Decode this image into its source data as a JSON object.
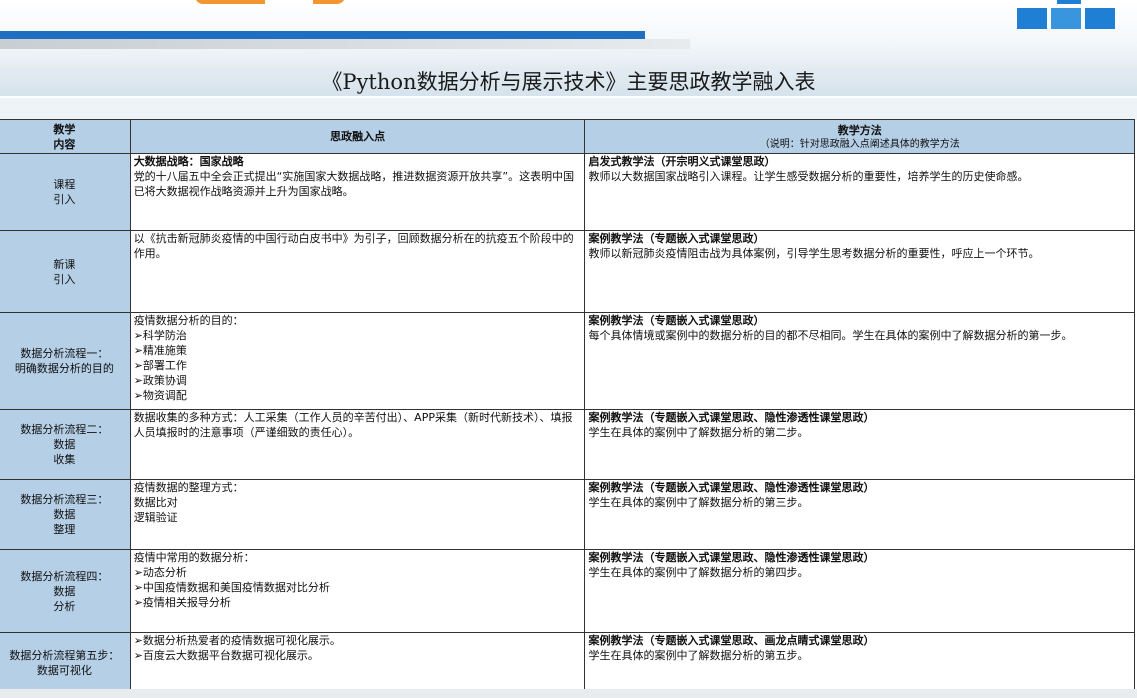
{
  "title": "《Python数据分析与展示技术》主要思政教学融入表",
  "table": {
    "headers": {
      "c1_line1": "教学",
      "c1_line2": "内容",
      "c2": "思政融入点",
      "c3_line1": "教学方法",
      "c3_line2": "（说明：针对思政融入点阐述具体的教学方法"
    },
    "rows": [
      {
        "content": [
          "课程",
          "引入"
        ],
        "point_title": "大数据战略：国家战略",
        "point_lines": [
          "党的十八届五中全会正式提出“实施国家大数据战略，推进数据资源开放共享”。这表明中国已将大数据视作战略资源并上升为国家战略。"
        ],
        "method_title": "启发式教学法（开宗明义式课堂思政）",
        "method_text": "教师以大数据国家战略引入课程。让学生感受数据分析的重要性，培养学生的历史使命感。"
      },
      {
        "content": [
          "新课",
          "引入"
        ],
        "point_title": "",
        "point_lines": [
          "以《抗击新冠肺炎疫情的中国行动白皮书中》为引子，回顾数据分析在的抗疫五个阶段中的作用。"
        ],
        "method_title": "案例教学法（专题嵌入式课堂思政）",
        "method_text": "教师以新冠肺炎疫情阻击战为具体案例，引导学生思考数据分析的重要性，呼应上一个环节。"
      },
      {
        "content": [
          "数据分析流程一：",
          "明确数据分析的目的"
        ],
        "point_title": "",
        "point_lines": [
          "疫情数据分析的目的：",
          "➢科学防治",
          "➢精准施策",
          "➢部署工作",
          "➢政策协调",
          "➢物资调配"
        ],
        "method_title": "案例教学法（专题嵌入式课堂思政）",
        "method_text": "每个具体情境或案例中的数据分析的目的都不尽相同。学生在具体的案例中了解数据分析的第一步。"
      },
      {
        "content": [
          "数据分析流程二：",
          "数据",
          "收集"
        ],
        "point_title": "",
        "point_lines": [
          "数据收集的多种方式：人工采集（工作人员的辛苦付出）、APP采集（新时代新技术）、填报人员填报时的注意事项（严谨细致的责任心）。"
        ],
        "method_title": "案例教学法（专题嵌入式课堂思政、隐性渗透性课堂思政）",
        "method_text": "学生在具体的案例中了解数据分析的第二步。"
      },
      {
        "content": [
          "数据分析流程三：",
          "数据",
          "整理"
        ],
        "point_title": "",
        "point_lines": [
          "疫情数据的整理方式：",
          "数据比对",
          "逻辑验证"
        ],
        "method_title": "案例教学法（专题嵌入式课堂思政、隐性渗透性课堂思政）",
        "method_text": "学生在具体的案例中了解数据分析的第三步。"
      },
      {
        "content": [
          "数据分析流程四：",
          "数据",
          "分析"
        ],
        "point_title": "",
        "point_lines": [
          "疫情中常用的数据分析：",
          "➢动态分析",
          "➢中国疫情数据和美国疫情数据对比分析",
          "➢疫情相关报导分析"
        ],
        "method_title": "案例教学法（专题嵌入式课堂思政、隐性渗透性课堂思政）",
        "method_text": "学生在具体的案例中了解数据分析的第四步。"
      },
      {
        "content": [
          "数据分析流程第五步：",
          "数据可视化"
        ],
        "point_title": "",
        "point_lines": [
          "➢数据分析热爱者的疫情数据可视化展示。",
          "➢百度云大数据平台数据可视化展示。"
        ],
        "method_title": "案例教学法（专题嵌入式课堂思政、画龙点睛式课堂思政）",
        "method_text": "学生在具体的案例中了解数据分析的第五步。"
      }
    ]
  }
}
